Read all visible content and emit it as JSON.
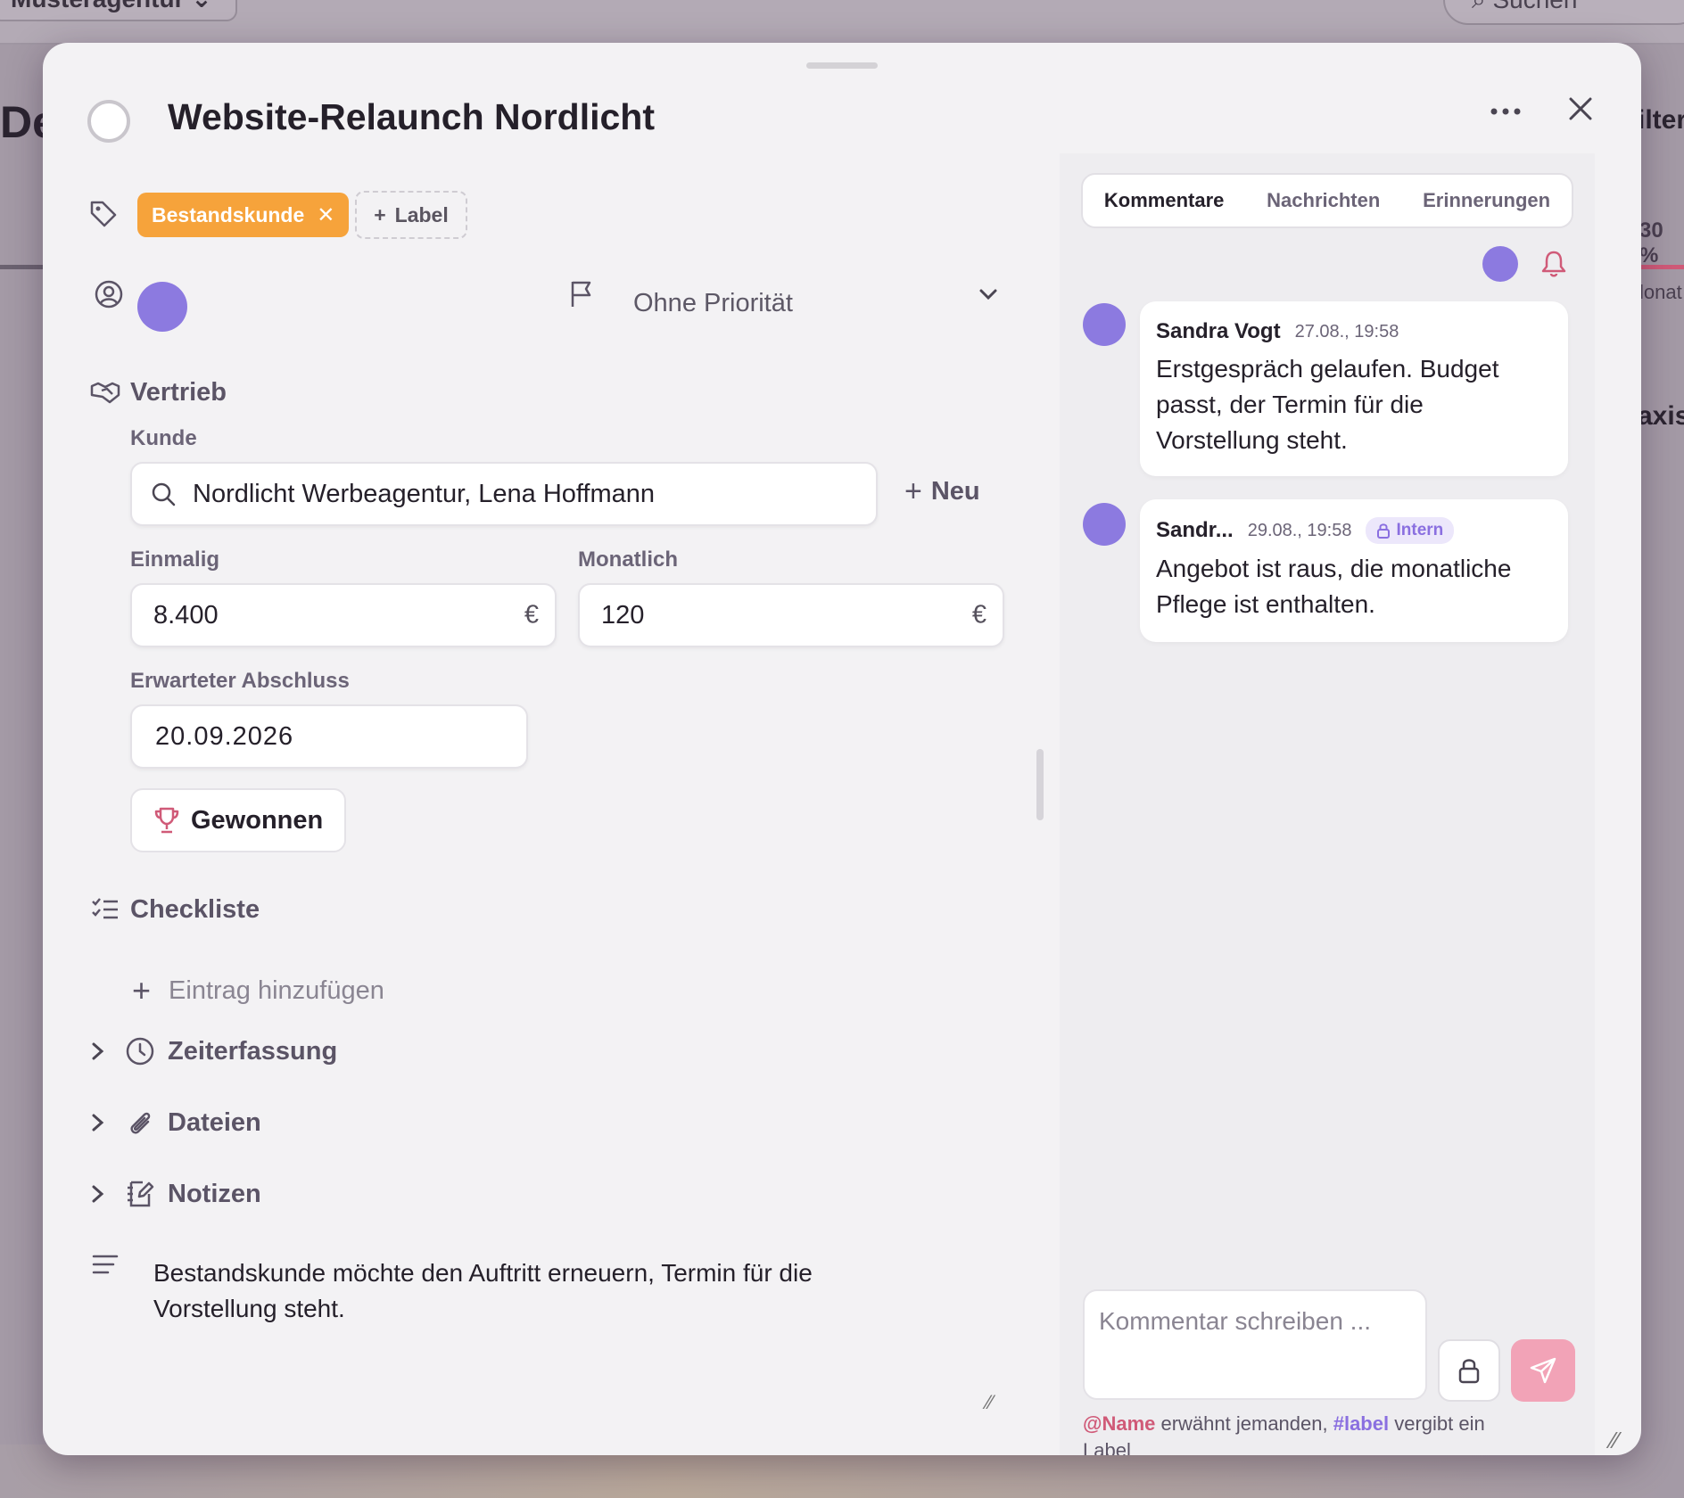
{
  "background": {
    "agency": "Musteragentur",
    "search": "Suchen",
    "heading": "De",
    "filter": "ilter",
    "pct": "30 %",
    "monat": "lonat",
    "praxis": "axis"
  },
  "modal": {
    "title": "Website-Relaunch Nordlicht",
    "labels": [
      {
        "text": "Bestandskunde",
        "color": "#f6a33b"
      }
    ],
    "add_label": "Label",
    "priority": "Ohne Priorität",
    "sales": {
      "section": "Vertrieb",
      "customer_label": "Kunde",
      "customer_value": "Nordlicht Werbeagentur, Lena Hoffmann",
      "new_button": "Neu",
      "once_label": "Einmalig",
      "once_value": "8.400",
      "monthly_label": "Monatlich",
      "monthly_value": "120",
      "currency": "€",
      "close_label": "Erwarteter Abschluss",
      "close_value": "20.09.2026",
      "won_button": "Gewonnen"
    },
    "checklist": {
      "title": "Checkliste",
      "add_entry": "Eintrag hinzufügen"
    },
    "sections": [
      "Zeiterfassung",
      "Dateien",
      "Notizen"
    ],
    "description": "Bestandskunde möchte den Auftritt erneuern, Termin für die Vorstellung steht."
  },
  "comments_pane": {
    "tabs": [
      "Kommentare",
      "Nachrichten",
      "Erinnerungen"
    ],
    "active_tab": "Kommentare",
    "comments": [
      {
        "author": "Sandra Vogt",
        "time": "27.08., 19:58",
        "text": "Erstgespräch gelaufen. Budget passt, der Termin für die Vorstellung steht."
      },
      {
        "author": "Sandr...",
        "time": "29.08., 19:58",
        "badge": "Intern",
        "text": "Angebot ist raus, die monatliche Pflege ist enthalten."
      }
    ],
    "input_placeholder": "Kommentar schreiben ...",
    "hint_mention": "@Name",
    "hint_mention_text": " erwähnt jemanden, ",
    "hint_tag": "#label",
    "hint_tag_text": " vergibt ein Label"
  },
  "colors": {
    "accent": "#8c7ae0",
    "label_orange": "#f6a33b",
    "pink": "#d05a78",
    "send_button": "#f2a3b7"
  }
}
